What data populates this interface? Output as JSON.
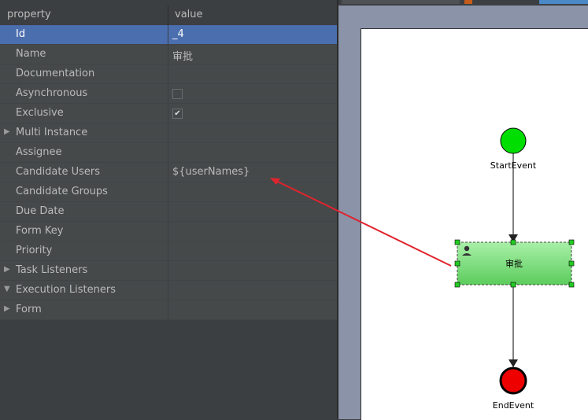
{
  "properties": {
    "header": {
      "property": "property",
      "value": "value"
    },
    "rows": [
      {
        "name": "Id",
        "value": "_4",
        "selected": true
      },
      {
        "name": "Name",
        "value": "审批"
      },
      {
        "name": "Documentation",
        "value": ""
      },
      {
        "name": "Asynchronous",
        "checkbox": true,
        "checked": false
      },
      {
        "name": "Exclusive",
        "checkbox": true,
        "checked": true
      },
      {
        "name": "Multi Instance",
        "value": "",
        "expander": "collapsed"
      },
      {
        "name": "Assignee",
        "value": ""
      },
      {
        "name": "Candidate Users",
        "value": "${userNames}"
      },
      {
        "name": "Candidate Groups",
        "value": ""
      },
      {
        "name": "Due Date",
        "value": ""
      },
      {
        "name": "Form Key",
        "value": ""
      },
      {
        "name": "Priority",
        "value": ""
      },
      {
        "name": "Task Listeners",
        "value": "",
        "expander": "collapsed"
      },
      {
        "name": "Execution Listeners",
        "value": "",
        "expander": "expanded"
      },
      {
        "name": "Form",
        "value": "",
        "expander": "collapsed"
      }
    ]
  },
  "diagram": {
    "start_event": {
      "label": "StartEvent",
      "color": "#00dd00"
    },
    "user_task": {
      "label": "审批",
      "icon": "user-icon",
      "color": "#80e080",
      "selected": true
    },
    "end_event": {
      "label": "EndEvent",
      "color": "#ee0000"
    }
  },
  "annotation": {
    "arrow_color": "#e0242e"
  },
  "colors": {
    "panel_bg": "#3c3f41",
    "row_bg": "#45494a",
    "selected_row": "#4b6eaf",
    "canvas_bg": "#8a93a8"
  }
}
